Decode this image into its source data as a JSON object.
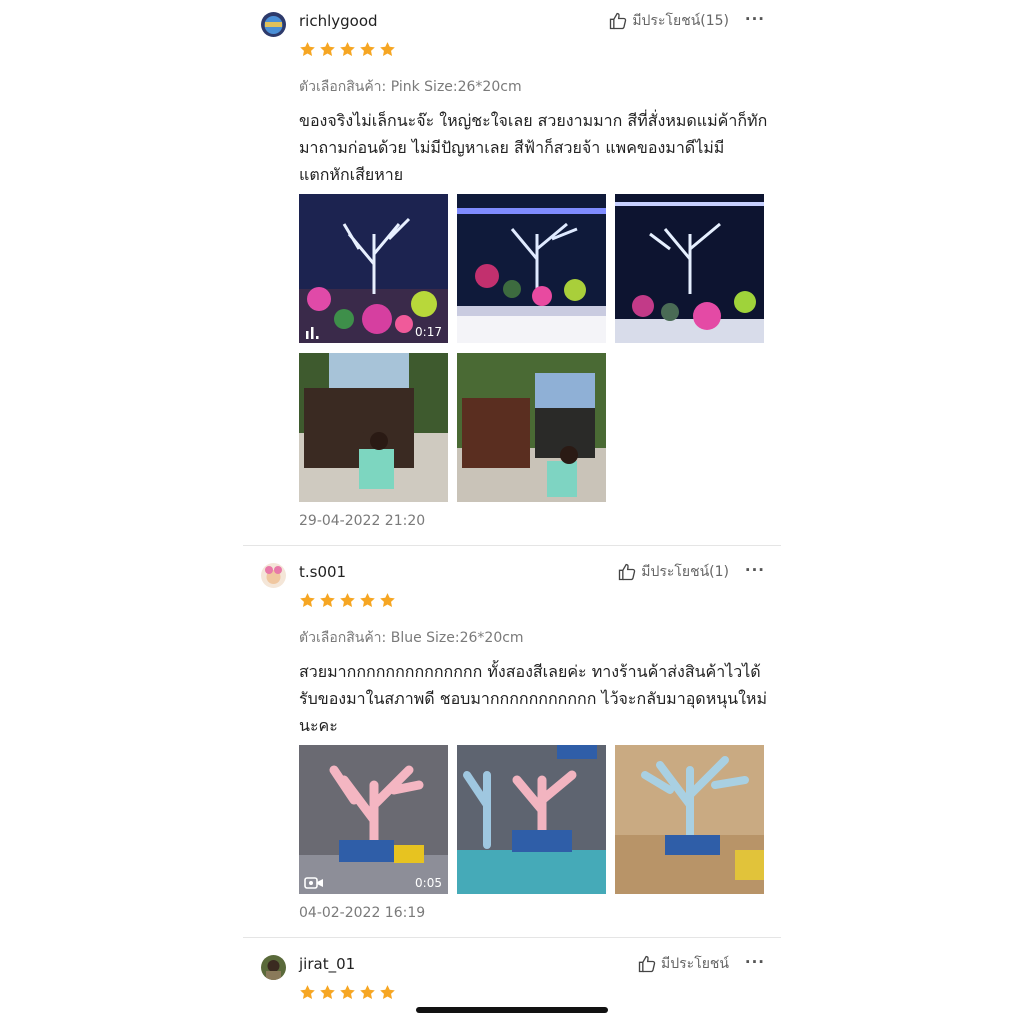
{
  "reviews": [
    {
      "username": "richlygood",
      "helpful_label": "มีประโยชน์(15)",
      "more": "···",
      "rating": 5,
      "variant": "ตัวเลือกสินค้า: Pink Size:26*20cm",
      "text": "ของจริงไม่เล็กนะจ๊ะ ใหญ่ชะใจเลย สวยงามมาก สีที่สั่งหมดแม่ค้าก็ทักมาถามก่อนด้วย ไม่มีปัญหาเลย สีฟ้าก็สวยจ้า แพคของมาดีไม่มีแตกหักเสียหาย",
      "video_duration": "0:17",
      "date": "29-04-2022 21:20"
    },
    {
      "username": "t.s001",
      "helpful_label": "มีประโยชน์(1)",
      "more": "···",
      "rating": 5,
      "variant": "ตัวเลือกสินค้า: Blue Size:26*20cm",
      "text": "สวยมากกกกกกกกกกกกกก ทั้งสองสีเลยค่ะ ทางร้านค้าส่งสินค้าไวได้รับของมาในสภาพดี ชอบมากกกกกกกกกกก ไว้จะกลับมาอุดหนุนใหม่นะคะ",
      "video_duration": "0:05",
      "date": "04-02-2022 16:19"
    },
    {
      "username": "jirat_01",
      "helpful_label": "มีประโยชน์",
      "more": "···",
      "rating": 5
    }
  ],
  "colors": {
    "star": "#F6A623",
    "muted": "#7a7a7a",
    "divider": "#e5e5e5"
  },
  "icons": [
    "thumbs-up-icon",
    "more-options-icon",
    "star-icon",
    "video-bars-icon",
    "video-camera-icon"
  ]
}
